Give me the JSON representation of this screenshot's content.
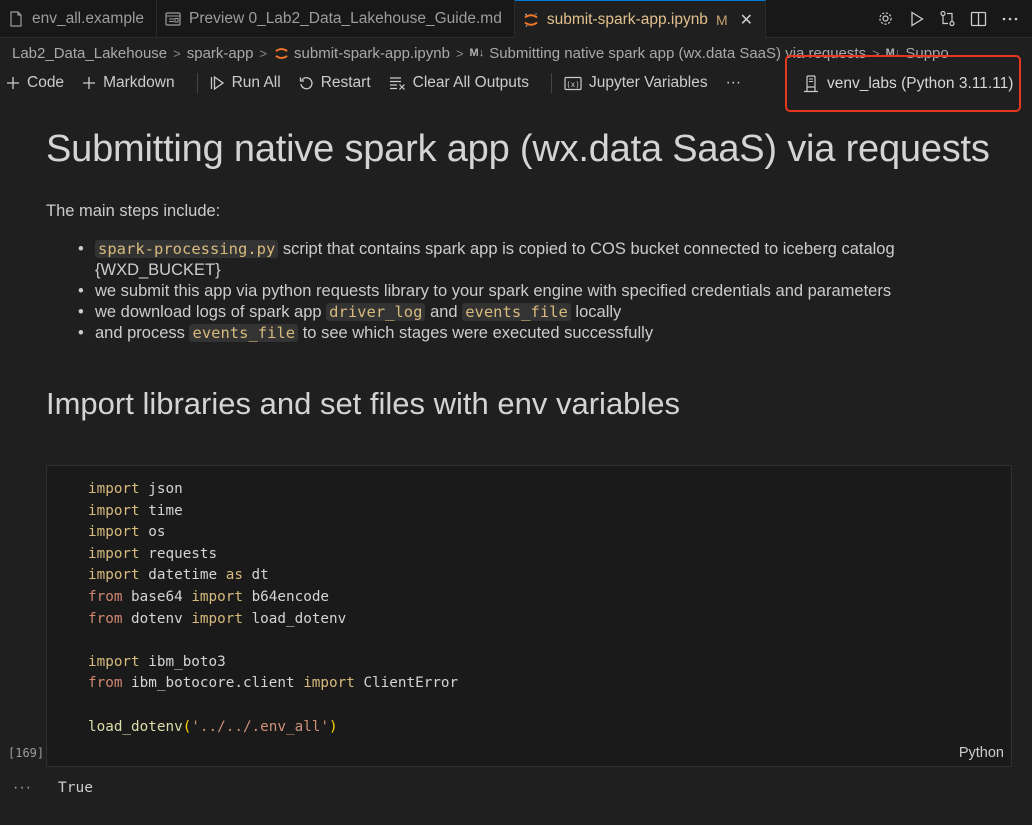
{
  "tabs": [
    {
      "label": "env_all.example",
      "icon": "file-icon",
      "active": false
    },
    {
      "label": "Preview 0_Lab2_Data_Lakehouse_Guide.md",
      "icon": "preview-icon",
      "active": false
    },
    {
      "label": "submit-spark-app.ipynb",
      "icon": "jupyter-icon",
      "active": true,
      "modified_badge": "M"
    }
  ],
  "tab_actions": [
    "gear-icon",
    "run-icon",
    "compare-icon",
    "split-editor-icon",
    "more-icon"
  ],
  "breadcrumb": {
    "items": [
      "Lab2_Data_Lakehouse",
      "spark-app",
      "submit-spark-app.ipynb",
      "Submitting native spark app (wx.data SaaS) via requests",
      "Suppo"
    ],
    "md_badge": "M↓"
  },
  "toolbar": {
    "code": "Code",
    "markdown": "Markdown",
    "run_all": "Run All",
    "restart": "Restart",
    "clear_outputs": "Clear All Outputs",
    "jupyter_variables": "Jupyter Variables",
    "more": "···",
    "kernel": "venv_labs (Python 3.11.11)",
    "accent_highlight": "#e5391f"
  },
  "notebook": {
    "title": "Submitting native spark app (wx.data SaaS) via requests",
    "intro": "The main steps include:",
    "steps": {
      "s1_code": "spark-processing.py",
      "s1_text": " script that contains spark app is copied to COS bucket connected to iceberg catalog {WXD_BUCKET}",
      "s2_text": "we submit this app via python requests library to your spark engine with specified credentials and parameters",
      "s3_pre": "we download logs of spark app ",
      "s3_code1": "driver_log",
      "s3_mid": " and ",
      "s3_code2": "events_file",
      "s3_post": " locally",
      "s4_pre": "and process ",
      "s4_code": "events_file",
      "s4_post": " to see which stages were executed successfully"
    },
    "section_title": "Import libraries and set files with env variables",
    "cell": {
      "execution_count": "[169]",
      "language": "Python",
      "output": "True",
      "output_menu": "···"
    }
  }
}
